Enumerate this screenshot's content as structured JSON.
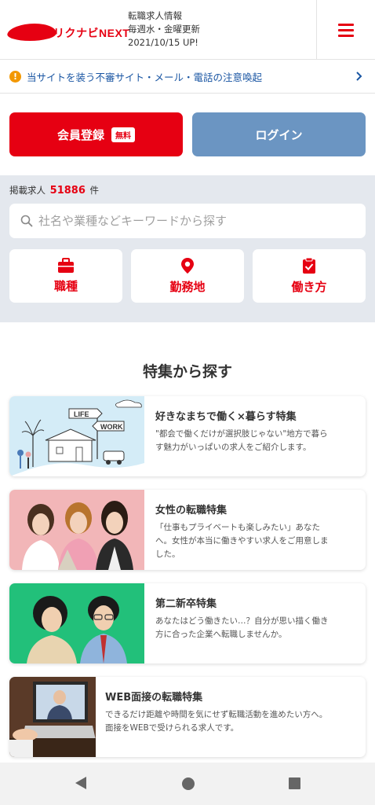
{
  "header": {
    "logo_text": "リクナビNEXT",
    "info_line1": "転職求人情報",
    "info_line2": "毎週水・金曜更新",
    "info_line3": "2021/10/15 UP!",
    "menu_icon": "hamburger-menu-icon"
  },
  "notice": {
    "icon": "!",
    "text": "当サイトを装う不審サイト・メール・電話の注意喚起"
  },
  "auth": {
    "register_label": "会員登録",
    "free_badge": "無料",
    "login_label": "ログイン"
  },
  "search": {
    "count_prefix": "掲載求人",
    "count_value": "51886",
    "count_suffix": "件",
    "placeholder": "社名や業種などキーワードから探す",
    "categories": [
      {
        "label": "職種",
        "icon": "briefcase-icon"
      },
      {
        "label": "勤務地",
        "icon": "map-pin-icon"
      },
      {
        "label": "働き方",
        "icon": "clipboard-check-icon"
      }
    ]
  },
  "features": {
    "title": "特集から探す",
    "cards": [
      {
        "title": "好きなまちで働く×暮らす特集",
        "desc1": "\"都会で働くだけが選択肢じゃない\"地方で暮ら",
        "desc2": "す魅力がいっぱいの求人をご紹介します。",
        "desc3": "",
        "thumb_sign1": "LIFE",
        "thumb_sign2": "WORK"
      },
      {
        "title": "女性の転職特集",
        "desc1": "「仕事もプライベートも楽しみたい」あなた",
        "desc2": "へ。女性が本当に働きやすい求人をご用意しま",
        "desc3": "した。"
      },
      {
        "title": "第二新卒特集",
        "desc1": "あなたはどう働きたい…？自分が思い描く働き",
        "desc2": "方に合った企業へ転職しませんか。",
        "desc3": ""
      },
      {
        "title": "WEB面接の転職特集",
        "desc1": "できるだけ距離や時間を気にせず転職活動を進めたい方へ。",
        "desc2": "面接をWEBで受けられる求人です。",
        "desc3": ""
      }
    ]
  },
  "colors": {
    "brand_red": "#e60012",
    "login_blue": "#6b95c2",
    "notice_link": "#1a56a3",
    "warning_orange": "#f39800"
  }
}
